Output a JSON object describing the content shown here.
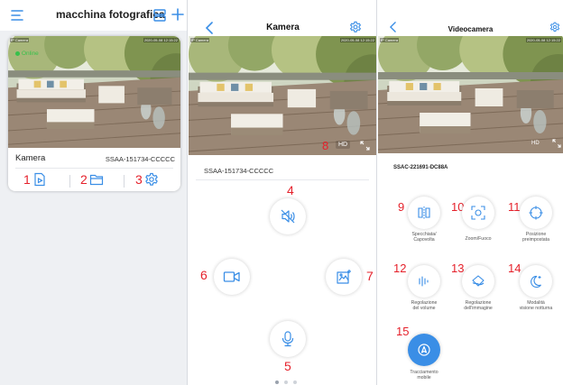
{
  "panel1": {
    "title": "macchina fotografica",
    "status": "Online",
    "camera_name": "Kamera",
    "camera_id": "SSAA-151734-CCCCC",
    "stamp_left": "IP Camera",
    "stamp_right": "2020-05-08 12:15:22",
    "actions": [
      {
        "num": "1",
        "icon": "playback-file-icon"
      },
      {
        "num": "2",
        "icon": "folder-icon"
      },
      {
        "num": "3",
        "icon": "gear-icon"
      }
    ]
  },
  "panel2": {
    "title": "Kamera",
    "device_id": "SSAA-151734-CCCCC",
    "stamp_left": "IP Camera",
    "stamp_right": "2020-05-08 12:15:22",
    "hd_label": "HD",
    "num_hd": "8",
    "num_mute": "4",
    "num_record": "6",
    "num_snapshot": "7",
    "num_mic": "5"
  },
  "panel3": {
    "title": "Videocamera",
    "device_id": "SSAC-221691-DC88A",
    "stamp_left": "IP Camera",
    "stamp_right": "2020-05-08 12:15:22",
    "hd_label": "HD",
    "features": [
      {
        "num": "9",
        "label": "Specchiata/\nCapovolta",
        "icon": "mirror-flip-icon"
      },
      {
        "num": "10",
        "label": "Zoom/Fuoco",
        "icon": "zoom-focus-icon"
      },
      {
        "num": "11",
        "label": "Posizione\npreimpostata",
        "icon": "preset-position-icon"
      },
      {
        "num": "12",
        "label": "Regolazione\ndel volume",
        "icon": "volume-bars-icon"
      },
      {
        "num": "13",
        "label": "Regolazione\ndell'immagine",
        "icon": "image-adjust-icon"
      },
      {
        "num": "14",
        "label": "Modalità\nvisione notturna",
        "icon": "night-vision-icon"
      },
      {
        "num": "15",
        "label": "Tracciamento\nmobile",
        "icon": "motion-tracking-icon"
      }
    ]
  },
  "colors": {
    "accent": "#3a8ee6",
    "annotation": "#e5212b",
    "online": "#37c14b"
  }
}
